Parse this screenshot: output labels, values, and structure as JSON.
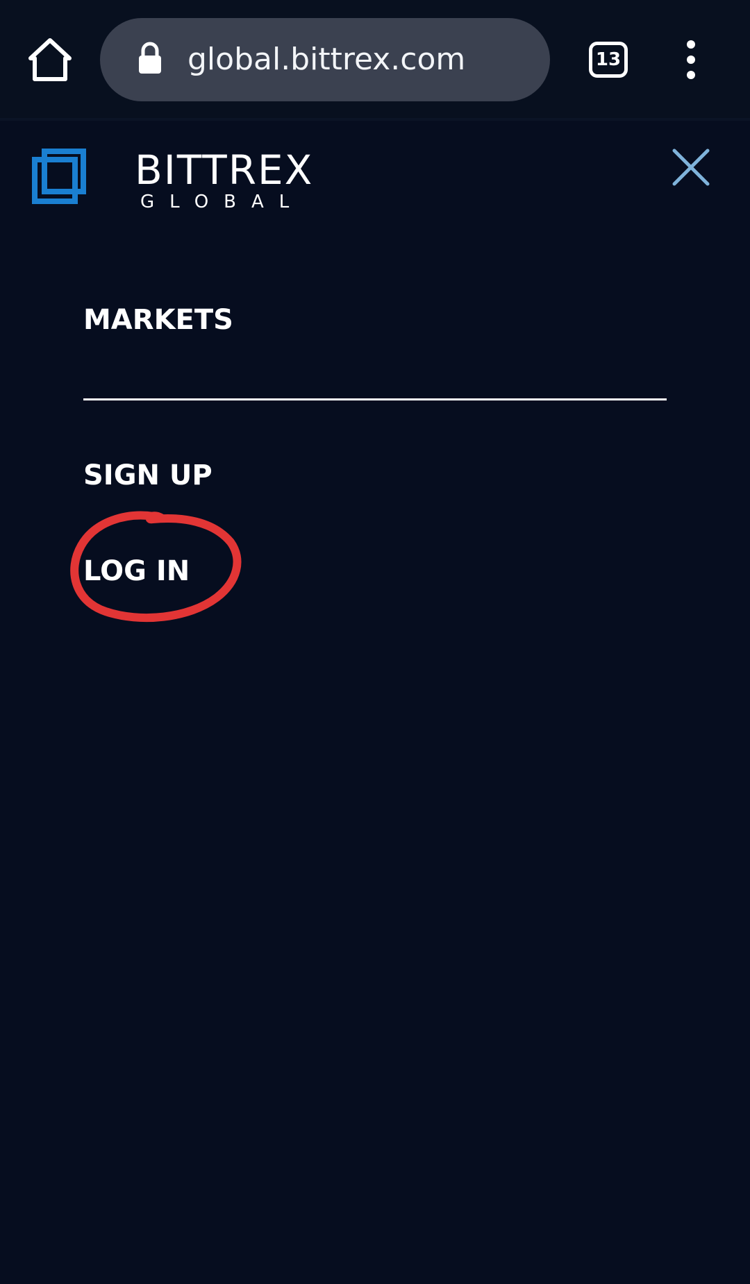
{
  "browser": {
    "url": "global.bittrex.com",
    "tab_count": "13",
    "icons": {
      "home": "home-icon",
      "lock": "lock-icon",
      "tabs": "tab-switcher-icon",
      "menu": "more-vert-icon"
    }
  },
  "header": {
    "logo_word": "BITTREX",
    "logo_sub": "GLOBAL",
    "close_icon": "close-icon",
    "colors": {
      "logo_blue": "#1a7fd1",
      "close_blue": "#7fb3db"
    }
  },
  "nav": {
    "items": [
      {
        "label": "MARKETS"
      },
      {
        "label": "SIGN UP"
      },
      {
        "label": "LOG IN"
      }
    ]
  },
  "annotation": {
    "type": "hand-drawn-circle",
    "target": "LOG IN",
    "color": "#e23535"
  },
  "colors": {
    "background": "#060d1f",
    "text": "#ffffff"
  }
}
